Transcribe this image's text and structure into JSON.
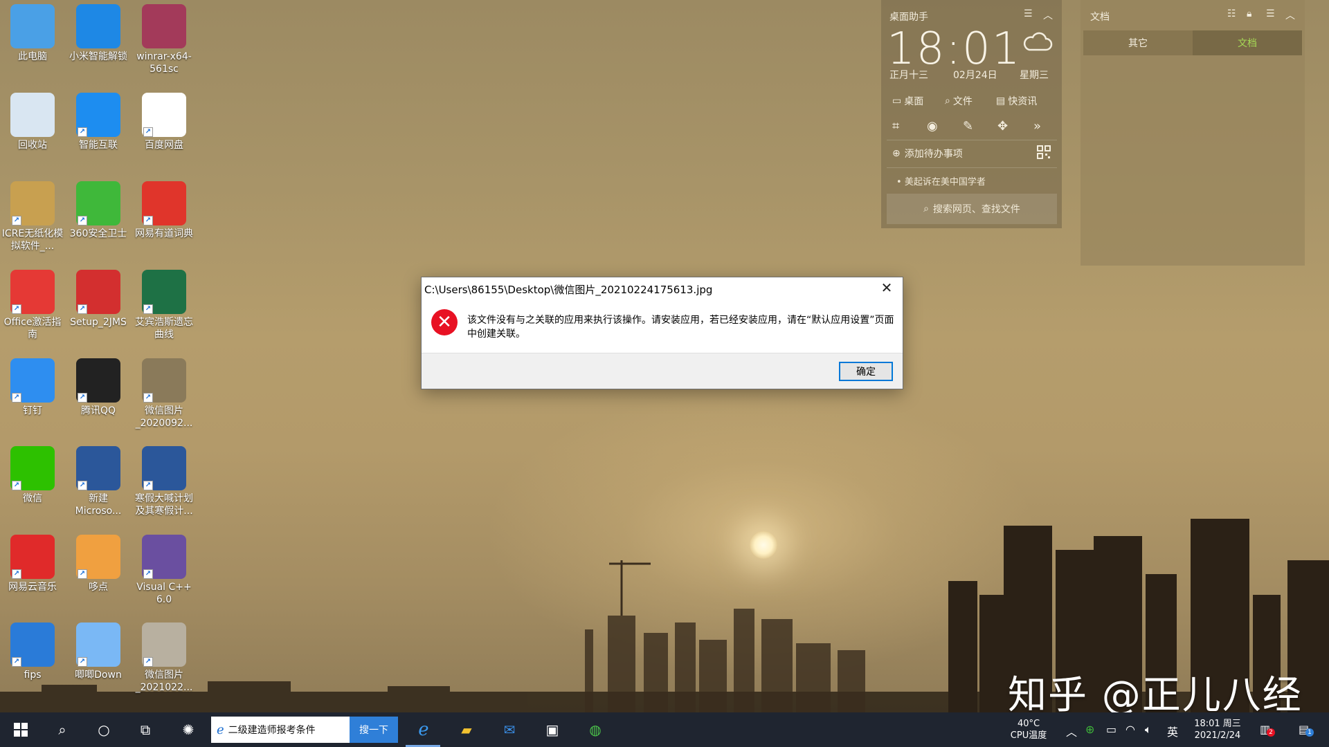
{
  "desktop": {
    "icons": [
      {
        "label": "此电脑",
        "icon": "computer-icon",
        "color": "#4aa0e6"
      },
      {
        "label": "小米智能解锁",
        "icon": "unlock-icon",
        "color": "#1e88e5"
      },
      {
        "label": "winrar-x64-561sc",
        "icon": "winrar-icon",
        "color": "#a33a5a"
      },
      {
        "label": "回收站",
        "icon": "recycle-bin-icon",
        "color": "#d9e6f2"
      },
      {
        "label": "智能互联",
        "icon": "smart-link-icon",
        "color": "#1d8df0"
      },
      {
        "label": "百度网盘",
        "icon": "baidu-netdisk-icon",
        "color": "#ffffff"
      },
      {
        "label": "ICRE无纸化模拟软件_...",
        "icon": "icre-icon",
        "color": "#c8a050"
      },
      {
        "label": "360安全卫士",
        "icon": "360-security-icon",
        "color": "#3fb83a"
      },
      {
        "label": "网易有道词典",
        "icon": "youdao-icon",
        "color": "#e0352b"
      },
      {
        "label": "Office激活指南",
        "icon": "pdf-icon",
        "color": "#e53935"
      },
      {
        "label": "Setup_2JMS",
        "icon": "setup-icon",
        "color": "#d32f2f"
      },
      {
        "label": "艾宾浩斯遗忘曲线",
        "icon": "excel-icon",
        "color": "#1e7145"
      },
      {
        "label": "钉钉",
        "icon": "dingtalk-icon",
        "color": "#2e8ef0"
      },
      {
        "label": "腾讯QQ",
        "icon": "qq-icon",
        "color": "#222222"
      },
      {
        "label": "微信图片_2020092...",
        "icon": "image-thumbnail-icon",
        "color": "#8a7a5a"
      },
      {
        "label": "微信",
        "icon": "wechat-icon",
        "color": "#2dc100"
      },
      {
        "label": "新建 Microso...",
        "icon": "word-icon",
        "color": "#2b579a"
      },
      {
        "label": "寒假大喊计划及其寒假计...",
        "icon": "word-icon",
        "color": "#2b579a"
      },
      {
        "label": "网易云音乐",
        "icon": "netease-music-icon",
        "color": "#e02a2a"
      },
      {
        "label": "哆点",
        "icon": "duodian-icon",
        "color": "#f0a040"
      },
      {
        "label": "Visual C++ 6.0",
        "icon": "visual-cpp-icon",
        "color": "#6a4fa0"
      },
      {
        "label": "fips",
        "icon": "fips-icon",
        "color": "#2a7bd8"
      },
      {
        "label": "唧唧Down",
        "icon": "jijidown-icon",
        "color": "#7ab8f5"
      },
      {
        "label": "微信图片_2021022...",
        "icon": "image-thumbnail-icon",
        "color": "#b8b0a0"
      }
    ]
  },
  "dialog": {
    "title": "C:\\Users\\86155\\Desktop\\微信图片_20210224175613.jpg",
    "message": "该文件没有与之关联的应用来执行该操作。请安装应用，若已经安装应用，请在“默认应用设置”页面中创建关联。",
    "ok_label": "确定",
    "close_glyph": "✕",
    "error_glyph": "✕",
    "error_color": "#e81123"
  },
  "widget": {
    "title": "桌面助手",
    "time": "18:01",
    "lunar": "正月十三",
    "date": "02月24日",
    "weekday": "星期三",
    "tabs": [
      "桌面",
      "文件",
      "快资讯"
    ],
    "todo_label": "添加待办事项",
    "news_item": "美起诉在美中国学者",
    "search_label": "搜索网页、查找文件"
  },
  "docs": {
    "title": "文档",
    "tabs": [
      "其它",
      "文档"
    ],
    "active_tab": "文档",
    "active_color": "#a6d955"
  },
  "watermark": "知乎 @正儿八经",
  "taskbar": {
    "search_text": "二级建造师报考条件",
    "search_button": "搜一下",
    "temp": "40°C",
    "temp_label": "CPU温度",
    "ime": "英",
    "clock_time": "18:01 周三",
    "clock_date": "2021/2/24",
    "notif_badge": "2",
    "action_center_badge": "1"
  }
}
